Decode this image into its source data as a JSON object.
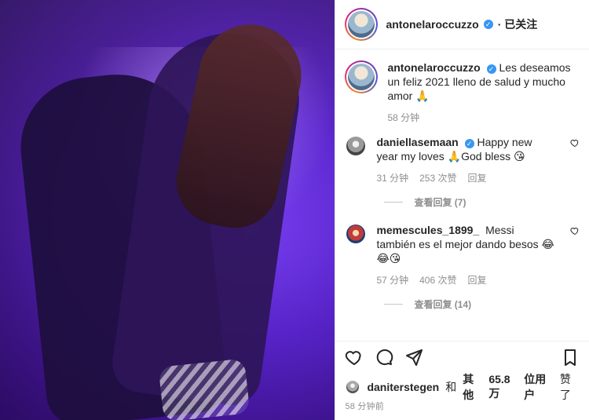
{
  "post": {
    "author": {
      "username": "antonelaroccuzzo",
      "verified": true,
      "follow_label": "· 已关注"
    },
    "caption": {
      "username": "antonelaroccuzzo",
      "text": "Les deseamos un feliz 2021 lleno de salud y mucho amor 🙏",
      "time": "58 分钟"
    },
    "comments": [
      {
        "username": "daniellasemaan",
        "verified": true,
        "text": "Happy new year my loves 🙏God bless 😘",
        "time": "31 分钟",
        "likes": "253 次赞",
        "reply_label": "回复",
        "view_replies_label": "查看回复 (7)"
      },
      {
        "username": "memescules_1899_",
        "verified": false,
        "text": "Messi también es el mejor dando besos 😂😂😘",
        "time": "57 分钟",
        "likes": "406 次赞",
        "reply_label": "回复",
        "view_replies_label": "查看回复 (14)"
      }
    ],
    "liked_by": {
      "username": "daniterstegen",
      "joiner": "和",
      "others_label": "其他",
      "count": "65.8万",
      "unit": "位用户",
      "suffix": "赞了"
    },
    "posted_time": "58 分钟前"
  },
  "icons": {
    "verified": "verified-badge",
    "like": "heart-icon",
    "comment": "comment-icon",
    "share": "share-icon",
    "save": "bookmark-icon"
  }
}
